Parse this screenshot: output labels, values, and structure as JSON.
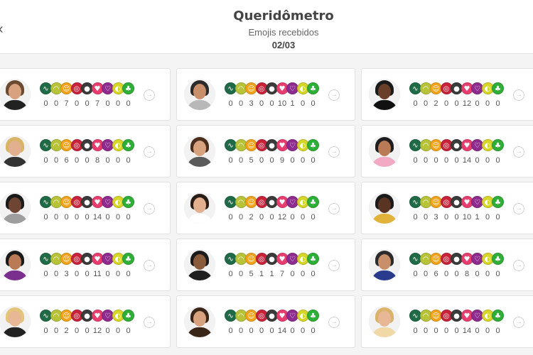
{
  "header": {
    "back_icon": "chevron-left-icon",
    "title": "Queridômetro",
    "subtitle": "Emojis recebidos",
    "date": "02/03"
  },
  "emoji_types": [
    {
      "name": "snake",
      "color": "#1f6b47",
      "glyph": "∿"
    },
    {
      "name": "banana",
      "color": "#b7c43a",
      "glyph": "◠"
    },
    {
      "name": "smile",
      "color": "#f2a31b",
      "glyph": "☺"
    },
    {
      "name": "target",
      "color": "#c8233b",
      "glyph": "◎"
    },
    {
      "name": "bomb",
      "color": "#3b3b3b",
      "glyph": "●"
    },
    {
      "name": "heart",
      "color": "#e83e6f",
      "glyph": "♥"
    },
    {
      "name": "broken-heart",
      "color": "#8e2b8e",
      "glyph": "♡"
    },
    {
      "name": "lemon",
      "color": "#d6d629",
      "glyph": "◐"
    },
    {
      "name": "plant",
      "color": "#2fae38",
      "glyph": "♣"
    }
  ],
  "participants": [
    {
      "counts": [
        "0",
        "0",
        "7",
        "0",
        "0",
        "7",
        "0",
        "0",
        "0"
      ],
      "skin": "#d9a27f",
      "hair": "#6b4a32",
      "shirt": "#222222"
    },
    {
      "counts": [
        "0",
        "0",
        "3",
        "0",
        "0",
        "10",
        "1",
        "0",
        "0"
      ],
      "skin": "#c98e6a",
      "hair": "#2b2b2b",
      "shirt": "#b8b8b8"
    },
    {
      "counts": [
        "0",
        "0",
        "2",
        "0",
        "0",
        "12",
        "0",
        "0",
        "0"
      ],
      "skin": "#6a3f2a",
      "hair": "#1a1a1a",
      "shirt": "#111111"
    },
    {
      "counts": [
        "0",
        "0",
        "6",
        "0",
        "0",
        "8",
        "0",
        "0",
        "0"
      ],
      "skin": "#e2b08e",
      "hair": "#d8b467",
      "shirt": "#333333"
    },
    {
      "counts": [
        "0",
        "0",
        "5",
        "0",
        "0",
        "9",
        "0",
        "0",
        "0"
      ],
      "skin": "#d9a27f",
      "hair": "#4a2e1d",
      "shirt": "#5a5a5a"
    },
    {
      "counts": [
        "0",
        "0",
        "0",
        "0",
        "0",
        "14",
        "0",
        "0",
        "0"
      ],
      "skin": "#b97a55",
      "hair": "#1e1e1e",
      "shirt": "#f2a9c4"
    },
    {
      "counts": [
        "0",
        "0",
        "0",
        "0",
        "0",
        "14",
        "0",
        "0",
        "0"
      ],
      "skin": "#6e4532",
      "hair": "#1a1a1a",
      "shirt": "#9e9e9e"
    },
    {
      "counts": [
        "0",
        "0",
        "2",
        "0",
        "0",
        "12",
        "0",
        "0",
        "0"
      ],
      "skin": "#e2b08e",
      "hair": "#2a1d16",
      "shirt": "#ffffff"
    },
    {
      "counts": [
        "0",
        "0",
        "3",
        "0",
        "0",
        "10",
        "1",
        "0",
        "0"
      ],
      "skin": "#5a3422",
      "hair": "#1a1a1a",
      "shirt": "#e2b33a"
    },
    {
      "counts": [
        "0",
        "0",
        "3",
        "0",
        "0",
        "11",
        "0",
        "0",
        "0"
      ],
      "skin": "#b97a55",
      "hair": "#1a1a1a",
      "shirt": "#7a2f8e"
    },
    {
      "counts": [
        "0",
        "0",
        "5",
        "1",
        "1",
        "7",
        "0",
        "0",
        "0"
      ],
      "skin": "#8a5a3c",
      "hair": "#1a1a1a",
      "shirt": "#1f1f1f"
    },
    {
      "counts": [
        "0",
        "0",
        "6",
        "0",
        "0",
        "8",
        "0",
        "0",
        "0"
      ],
      "skin": "#c98e6a",
      "hair": "#2b2b2b",
      "shirt": "#2a3b8e"
    },
    {
      "counts": [
        "0",
        "0",
        "2",
        "0",
        "0",
        "12",
        "0",
        "0",
        "0"
      ],
      "skin": "#e8b896",
      "hair": "#e3c47a",
      "shirt": "#222222"
    },
    {
      "counts": [
        "0",
        "0",
        "0",
        "0",
        "0",
        "14",
        "0",
        "0",
        "0"
      ],
      "skin": "#d9a27f",
      "hair": "#3a2618",
      "shirt": "#3a2618"
    },
    {
      "counts": [
        "0",
        "0",
        "0",
        "0",
        "0",
        "14",
        "0",
        "0",
        "0"
      ],
      "skin": "#e8b896",
      "hair": "#d9b36a",
      "shirt": "#f0d9a6"
    }
  ],
  "go_icon": "arrow-right-circle-icon"
}
